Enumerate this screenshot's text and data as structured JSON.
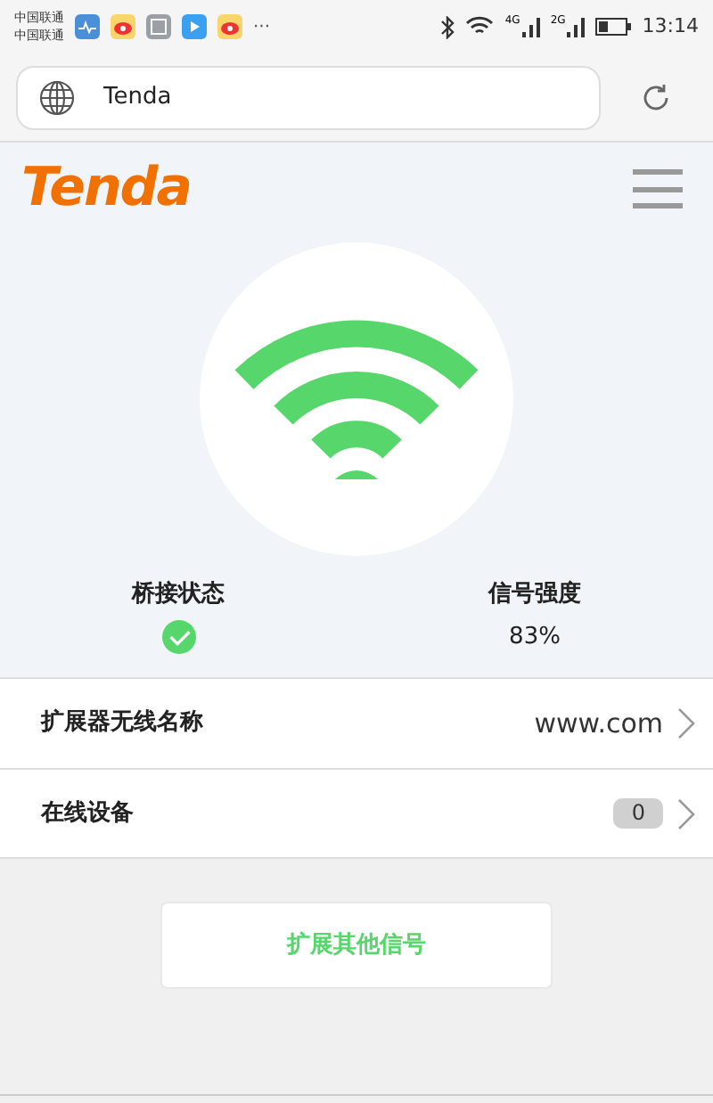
{
  "status_bar": {
    "carriers": [
      "中国联通",
      "中国联通"
    ],
    "more": "···",
    "network_labels": [
      "4G",
      "2G"
    ],
    "time": "13:14"
  },
  "address_bar": {
    "url": "Tenda"
  },
  "header": {
    "logo": "Tenda"
  },
  "status": [
    {
      "kind": "check",
      "label": "桥接状态",
      "connected": true
    },
    {
      "kind": "text",
      "label": "信号强度",
      "value": "83%"
    }
  ],
  "list": [
    {
      "kind": "text",
      "label": "扩展器无线名称",
      "value": "www.com"
    },
    {
      "kind": "badge",
      "label": "在线设备",
      "value": "0"
    }
  ],
  "button": "扩展其他信号"
}
